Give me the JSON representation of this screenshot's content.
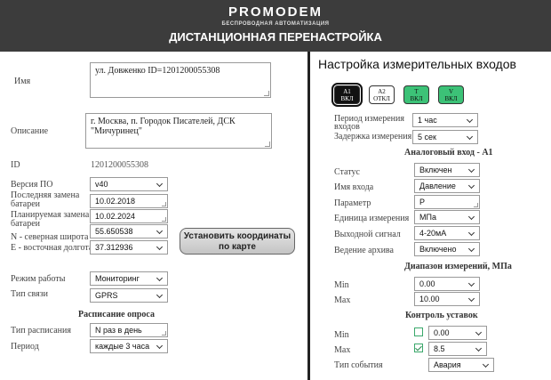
{
  "header": {
    "logo": "PROMODEM",
    "tagline": "БЕСПРОВОДНАЯ АВТОМАТИЗАЦИЯ",
    "title": "ДИСТАНЦИОННАЯ ПЕРЕНАСТРОЙКА"
  },
  "left": {
    "name_label": "Имя",
    "name_value": "ул. Довженко ID=1201200055308",
    "desc_label": "Описание",
    "desc_value": "г. Москва, п. Городок Писателей, ДСК \"Мичуринец\"",
    "id_label": "ID",
    "id_value": "1201200055308",
    "po_label": "Версия ПО",
    "po_value": "v40",
    "last_batt_label_1": "Последняя замена",
    "last_batt_label_2": "батареи",
    "last_batt_value": "10.02.2018",
    "plan_batt_label_1": "Планируемая замена",
    "plan_batt_label_2": "батареи",
    "plan_batt_value": "10.02.2024",
    "lat_label": "N - северная широта",
    "lat_value": "55.650538",
    "lon_label": "E - восточная долгота",
    "lon_value": "37.312936",
    "coord_button_line1": "Установить координаты",
    "coord_button_line2": "по карте",
    "mode_label": "Режим работы",
    "mode_value": "Мониторинг",
    "link_label": "Тип связи",
    "link_value": "GPRS",
    "schedule_heading": "Расписание опроса",
    "sched_type_label": "Тип расписания",
    "sched_type_value": "N раз в день",
    "period_label": "Период",
    "period_value": "каждые 3 часа"
  },
  "right": {
    "title": "Настройка измерительных входов",
    "channels": [
      {
        "name": "A1",
        "state": "ВКЛ"
      },
      {
        "name": "A2",
        "state": "ОТКЛ"
      },
      {
        "name": "T",
        "state": "ВКЛ"
      },
      {
        "name": "V",
        "state": "ВКЛ"
      }
    ],
    "period_label_1": "Период измерения",
    "period_label_2": "входов",
    "period_value": "1 час",
    "delay_label": "Задержка измерения",
    "delay_value": "5 сек",
    "analog_heading": "Аналоговый вход - A1",
    "status_label": "Статус",
    "status_value": "Включен",
    "input_name_label": "Имя входа",
    "input_name_value": "Давление",
    "param_label": "Параметр",
    "param_value": "Р",
    "unit_label": "Единица измерения",
    "unit_value": "МПа",
    "signal_label": "Выходной сигнал",
    "signal_value": "4-20мА",
    "archive_label": "Ведение архива",
    "archive_value": "Включено",
    "range_heading": "Диапазон измерений, МПа",
    "range_min_label": "Min",
    "range_min_value": "0.00",
    "range_max_label": "Max",
    "range_max_value": "10.00",
    "control_heading": "Контроль уставок",
    "ctrl_min_label": "Min",
    "ctrl_min_value": "0.00",
    "ctrl_max_label": "Max",
    "ctrl_max_value": "8.5",
    "event_label": "Тип события",
    "event_value": "Авария"
  }
}
